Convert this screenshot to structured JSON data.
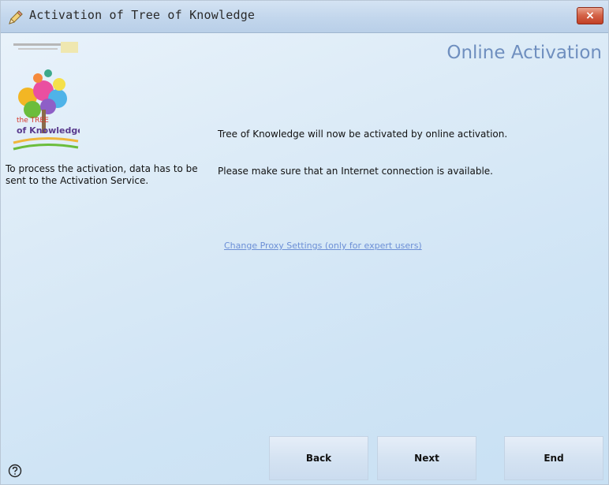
{
  "window": {
    "title": "Activation of Tree of Knowledge",
    "close_label": "×"
  },
  "header": {
    "title": "Online Activation"
  },
  "left_panel": {
    "logo_text": "the TREE of Knowledge",
    "info": "To process the activation, data has to be sent to the Activation Service."
  },
  "content": {
    "message_1": "Tree of Knowledge will now be activated by online activation.",
    "message_2": "Please make sure that an Internet connection is available.",
    "proxy_link": "Change Proxy Settings (only for expert users)"
  },
  "buttons": {
    "back": "Back",
    "next": "Next",
    "end": "End"
  },
  "icons": {
    "title": "pencil-icon",
    "close": "close-icon",
    "help": "help-icon"
  },
  "colors": {
    "header_title": "#6f8fbf",
    "link": "#6c8fd6",
    "close_button": "#c23f25"
  }
}
